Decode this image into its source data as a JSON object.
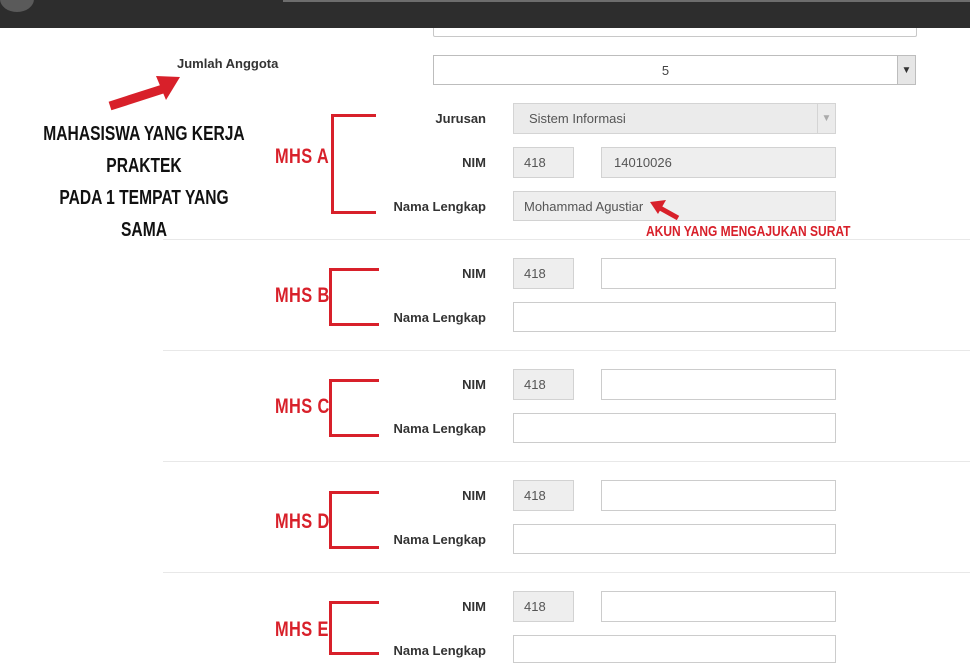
{
  "form": {
    "jumlah_anggota_label": "Jumlah Anggota",
    "jumlah_anggota_value": "5",
    "jurusan_label": "Jurusan",
    "jurusan_value": "Sistem Informasi",
    "nim_label": "NIM",
    "nama_label": "Nama Lengkap",
    "nim_prefix": "418",
    "members": [
      {
        "tag": "MHS A",
        "nim": "14010026",
        "nama": "Mohammad Agustiar"
      },
      {
        "tag": "MHS B",
        "nim": "",
        "nama": ""
      },
      {
        "tag": "MHS C",
        "nim": "",
        "nama": ""
      },
      {
        "tag": "MHS D",
        "nim": "",
        "nama": ""
      },
      {
        "tag": "MHS E",
        "nim": "",
        "nama": ""
      }
    ]
  },
  "annotations": {
    "left_note_line1": "MAHASISWA YANG KERJA PRAKTEK",
    "left_note_line2": "PADA 1 TEMPAT YANG SAMA",
    "akun_note": "AKUN YANG MENGAJUKAN SURAT",
    "annotation_color": "#d8202a"
  },
  "icons": {
    "select_arrow": "chevron-down-icon"
  }
}
